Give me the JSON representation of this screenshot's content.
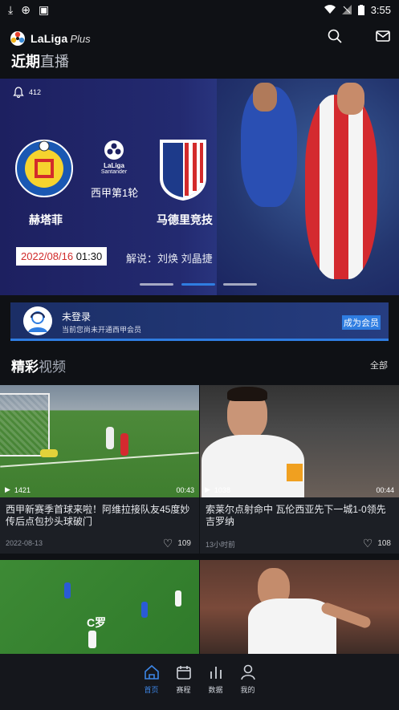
{
  "status_bar": {
    "time": "3:55"
  },
  "header": {
    "logo_text": "LaLiga",
    "logo_plus": "Plus",
    "title_accent": "近期",
    "title_rest": "直播"
  },
  "hero": {
    "bell_count": "412",
    "home_team": "赫塔菲",
    "away_team": "马德里竞技",
    "round": "西甲第1轮",
    "laliga_label": "LaLiga",
    "sponsor": "Santander",
    "date": "2022/08/16",
    "time": "01:30",
    "commentary": "解说：刘焕 刘晶捷",
    "active_slide_index": 1,
    "slide_count": 3
  },
  "member": {
    "status": "未登录",
    "subtitle": "当前您尚未开通西甲会员",
    "cta": "成为会员"
  },
  "highlights": {
    "title_accent": "精彩",
    "title_rest": "视频",
    "see_all": "全部",
    "cards": [
      {
        "views": "1421",
        "duration": "00:43",
        "title": "西甲新赛季首球来啦！阿维拉接队友45度妙传后点包抄头球破门",
        "date": "2022-08-13",
        "likes": "109"
      },
      {
        "views": "1038",
        "duration": "00:44",
        "title": "索莱尔点射命中 瓦伦西亚先下一城1-0领先吉罗纳",
        "date": "13小时前",
        "likes": "108"
      },
      {
        "overlay_text": "C罗"
      },
      {}
    ]
  },
  "tabbar": {
    "items": [
      {
        "label": "首页",
        "icon": "home-icon",
        "active": true
      },
      {
        "label": "赛程",
        "icon": "calendar-icon",
        "active": false
      },
      {
        "label": "数据",
        "icon": "bar-chart-icon",
        "active": false
      },
      {
        "label": "我的",
        "icon": "user-icon",
        "active": false
      }
    ]
  },
  "colors": {
    "accent": "#2f7de1",
    "background": "#0f1115",
    "date_red": "#d12b2b"
  }
}
